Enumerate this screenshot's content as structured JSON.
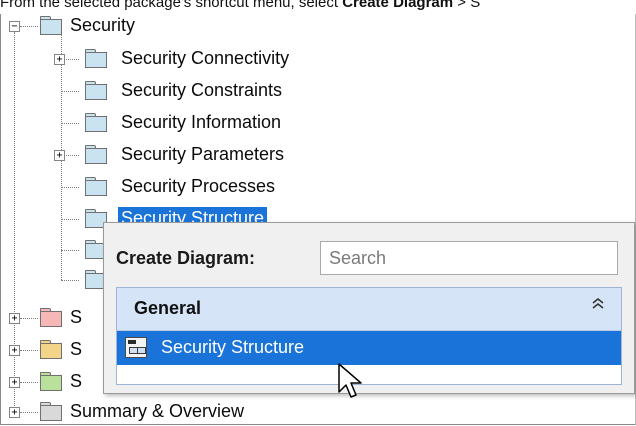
{
  "caption": {
    "prefix": "From the selected package's shortcut menu, select",
    "bold": "Create Diagram",
    "suffix": " > S"
  },
  "tree": {
    "root": {
      "label": "Security",
      "expander": "−",
      "color": "#c9e3f0"
    },
    "children": [
      {
        "label": "Security Connectivity",
        "expander": "+",
        "color": "#c9e3f0"
      },
      {
        "label": "Security Constraints",
        "expander": "",
        "color": "#c9e3f0"
      },
      {
        "label": "Security Information",
        "expander": "",
        "color": "#c9e3f0"
      },
      {
        "label": "Security Parameters",
        "expander": "+",
        "color": "#c9e3f0"
      },
      {
        "label": "Security Processes",
        "expander": "",
        "color": "#c9e3f0"
      },
      {
        "label": "Security Structure",
        "expander": "",
        "color": "#c9e3f0",
        "selected": true
      }
    ],
    "siblings": [
      {
        "label": "S",
        "expander": "+",
        "color": "#f7b7b7"
      },
      {
        "label": "S",
        "expander": "+",
        "color": "#f3d58a"
      },
      {
        "label": "S",
        "expander": "+",
        "color": "#b9e19b"
      },
      {
        "label": "Summary & Overview",
        "expander": "+",
        "color": "#d9d9d9"
      }
    ]
  },
  "popup": {
    "title": "Create Diagram:",
    "search_placeholder": "Search",
    "group_title": "General",
    "collapse_glyph": "⌃⌃",
    "item_label": "Security Structure"
  },
  "colors": {
    "selection": "#1a73d9",
    "group_header": "#d6e4f7",
    "popup_bg": "#f0f0f0"
  }
}
